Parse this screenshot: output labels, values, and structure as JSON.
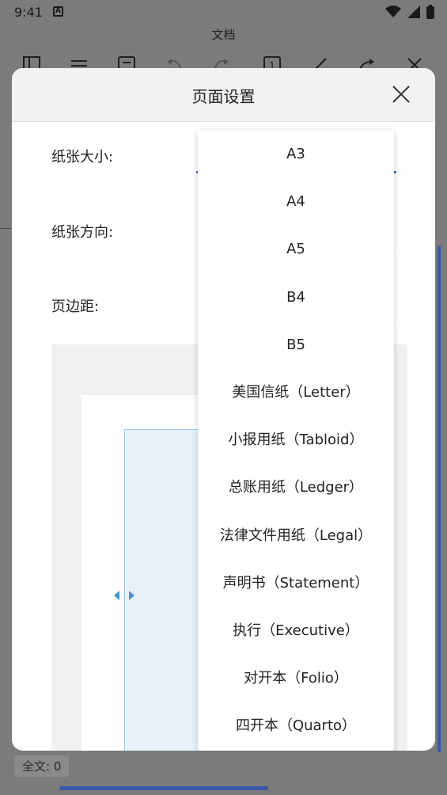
{
  "status_bar": {
    "time": "9:41"
  },
  "app": {
    "title": "文档",
    "word_count": "全文: 0"
  },
  "dialog": {
    "title": "页面设置",
    "labels": {
      "paper_size": "纸张大小:",
      "orientation": "纸张方向:",
      "margins": "页边距:"
    }
  },
  "dropdown": {
    "options": [
      "A3",
      "A4",
      "A5",
      "B4",
      "B5",
      "美国信纸（Letter）",
      "小报用纸（Tabloid）",
      "总账用纸（Ledger）",
      "法律文件用纸（Legal）",
      "声明书（Statement）",
      "执行（Executive）",
      "对开本（Folio）",
      "四开本（Quarto）"
    ]
  },
  "colors": {
    "accent": "#3b6fd4",
    "scroll_rail": "#3b56a8",
    "preview_fill": "#e8f1fa",
    "preview_border": "#9cc3e8"
  },
  "toolbar": {
    "page_number": "1"
  }
}
